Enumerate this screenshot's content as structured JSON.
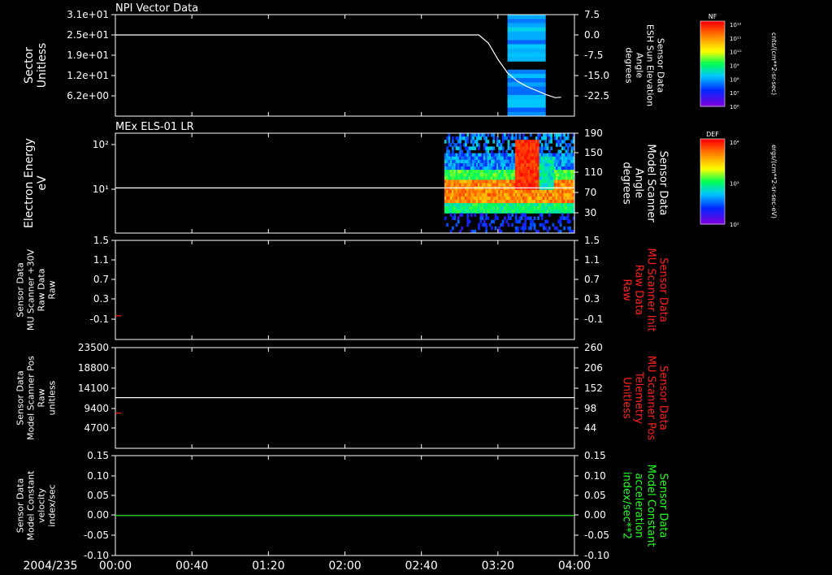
{
  "x_axis": {
    "start_label": "2004/235",
    "ticks": [
      "00:00",
      "00:40",
      "01:20",
      "02:00",
      "02:40",
      "03:20",
      "04:00"
    ],
    "range_minutes": [
      0,
      240
    ]
  },
  "colors": {
    "background": "#000000",
    "axis": "#ffffff",
    "red_label": "#ff2020",
    "green_label": "#20ff20"
  },
  "colorbars": [
    {
      "top_label": "NF",
      "ticks": [
        "10¹²",
        "10¹¹",
        "10¹⁰",
        "10⁹",
        "10⁸",
        "10⁷",
        "10⁶"
      ],
      "unit_label": "cnts/(cm**2-sr-sec)"
    },
    {
      "top_label": "DEF",
      "ticks": [
        "10⁴",
        "10³",
        "10²"
      ],
      "unit_label": "ergs/(cm**2-sr-sec-eV)"
    }
  ],
  "chart_data": [
    {
      "type": "line",
      "title": "NPI Vector Data",
      "left_label": [
        "Sector",
        "Unitless"
      ],
      "left_ticks": [
        "3.1e+01",
        "2.5e+01",
        "1.9e+01",
        "1.2e+01",
        "6.2e+00"
      ],
      "right_label": [
        "Sensor Data",
        "ESH Sun Elevation",
        "Angle",
        "degrees"
      ],
      "right_ticks": [
        "7.5",
        "0.0",
        "-7.5",
        "-15.0",
        "-22.5"
      ],
      "ylim_right": [
        -27.5,
        7.5
      ],
      "series": [
        {
          "color": "#ffffff",
          "x": [
            0,
            150,
            190,
            195,
            200,
            205,
            210,
            215,
            220,
            225,
            230,
            233
          ],
          "y": [
            0.0,
            0.0,
            0.0,
            -3.0,
            -9.0,
            -14.0,
            -17.0,
            -19.0,
            -20.5,
            -22.0,
            -23.2,
            -23.0
          ]
        }
      ],
      "spectrogram_x_range": [
        205,
        225
      ]
    },
    {
      "type": "heatmap",
      "title": "MEx ELS-01 LR",
      "left_label": [
        "Electron Energy",
        "eV"
      ],
      "left_ticks": [
        "10²",
        "10¹"
      ],
      "right_label": [
        "Sensor Data",
        "Model Scanner",
        "Angle",
        "degrees"
      ],
      "right_ticks": [
        "190",
        "150",
        "110",
        "70",
        "30"
      ],
      "ylim_right": [
        10,
        190
      ],
      "series": [
        {
          "color": "#ffffff",
          "x": [
            0,
            240
          ],
          "y": [
            80,
            80
          ]
        }
      ],
      "spectrogram_x_range": [
        172,
        240
      ]
    },
    {
      "type": "line",
      "left_label": [
        "Sensor Data",
        "MU Scanner +30V",
        "Raw Data",
        "Raw"
      ],
      "left_ticks": [
        "1.5",
        "1.1",
        "0.7",
        "0.3",
        "-0.1"
      ],
      "right_label": [
        "Sensor Data",
        "MU Scanner Init",
        "Raw Data",
        "Raw"
      ],
      "right_ticks": [
        "1.5",
        "1.1",
        "0.7",
        "0.3",
        "-0.1"
      ],
      "ylim_right": [
        -0.5,
        1.5
      ],
      "series": [
        {
          "color": "#ff2020",
          "x": [
            0,
            3
          ],
          "y": [
            -0.03,
            -0.03
          ]
        }
      ]
    },
    {
      "type": "line",
      "left_label": [
        "Sensor Data",
        "Model Scanner Pos",
        "Raw",
        "unitless"
      ],
      "left_ticks": [
        "23500",
        "18800",
        "14100",
        "9400",
        "4700"
      ],
      "right_label": [
        "Sensor Data",
        "MU Scanner Pos",
        "Telemetry",
        "Unitless"
      ],
      "right_ticks": [
        "260",
        "206",
        "152",
        "98",
        "44"
      ],
      "ylim_left": [
        0,
        23500
      ],
      "series": [
        {
          "color": "#ffffff",
          "x": [
            0,
            240
          ],
          "y": [
            11800,
            11800
          ]
        },
        {
          "color": "#ff2020",
          "x": [
            0,
            3
          ],
          "y": [
            8200,
            8200
          ]
        }
      ]
    },
    {
      "type": "line",
      "left_label": [
        "Sensor Data",
        "Model Constant",
        "velocity",
        "index/sec"
      ],
      "left_ticks": [
        "0.15",
        "0.10",
        "0.05",
        "0.00",
        "-0.05",
        "-0.10"
      ],
      "right_label": [
        "Sensor Data",
        "Model Constant",
        "acceleration",
        "index/sec**2"
      ],
      "right_ticks": [
        "0.15",
        "0.10",
        "0.05",
        "0.00",
        "-0.05",
        "-0.10"
      ],
      "ylim_left": [
        -0.1,
        0.15
      ],
      "series": [
        {
          "color": "#20ff20",
          "x": [
            0,
            240
          ],
          "y": [
            0.0,
            0.0
          ]
        }
      ]
    }
  ]
}
